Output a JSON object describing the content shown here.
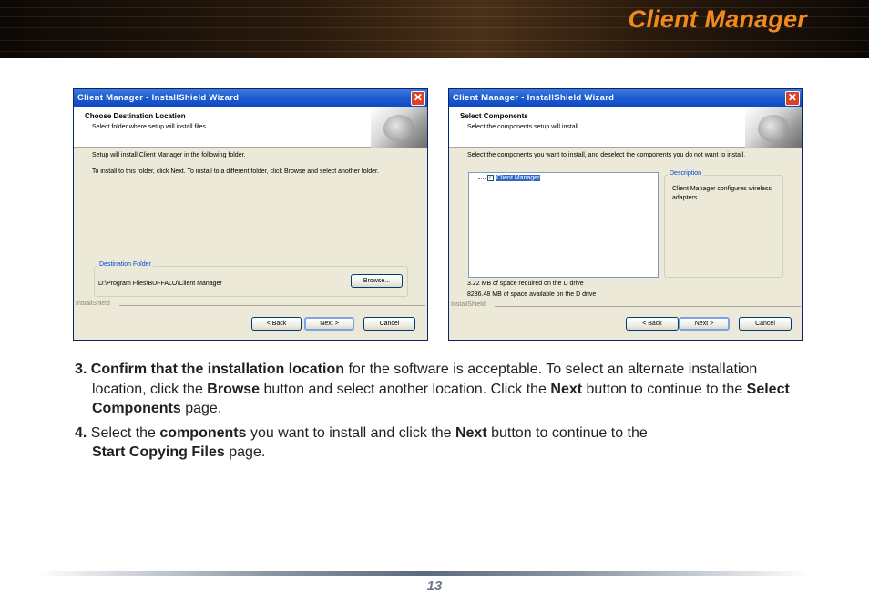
{
  "header": {
    "title": "Client Manager"
  },
  "dialog_left": {
    "window_title": "Client Manager - InstallShield Wizard",
    "close_glyph": "✕",
    "header_title": "Choose Destination Location",
    "header_subtitle": "Select folder where setup will install files.",
    "body_line1": "Setup will install Client Manager in the following folder.",
    "body_line2": "To install to this folder, click Next. To install to a different folder, click Browse and select another folder.",
    "group_label": "Destination Folder",
    "folder_path": "D:\\Program Files\\BUFFALO\\Client Manager",
    "browse_label": "Browse...",
    "installshield_label": "InstallShield",
    "back_label": "< Back",
    "next_label": "Next >",
    "cancel_label": "Cancel"
  },
  "dialog_right": {
    "window_title": "Client Manager - InstallShield Wizard",
    "close_glyph": "✕",
    "header_title": "Select Components",
    "header_subtitle": "Select the components setup will install.",
    "body_line1": "Select the components you want to install, and deselect the components you do not want to install.",
    "component_name": "Client Manager",
    "component_checked": true,
    "description_label": "Description",
    "description_text": "Client Manager configures wireless adapters.",
    "space_required": "3.22 MB of space required on the D drive",
    "space_available": "8236.48 MB of space available on the D drive",
    "installshield_label": "InstallShield",
    "back_label": "< Back",
    "next_label": "Next >",
    "cancel_label": "Cancel"
  },
  "steps": [
    {
      "number": "3.",
      "bold_lead": "Confirm that the installation location",
      "text1": " for the software is acceptable. To select an alternate installation location, click the ",
      "bold2": "Browse",
      "text2": " button and select another location. Click the ",
      "bold3": "Next",
      "text3": " button to continue to the ",
      "bold4": "Select Components",
      "text4": " page."
    },
    {
      "number": "4.",
      "text0": " Select the ",
      "bold1": "components",
      "text1": " you want to install and click the ",
      "bold2": "Next",
      "text2": " button to continue to the ",
      "bold3": "Start Copying Files",
      "text3": " page."
    }
  ],
  "footer": {
    "page_number": "13"
  },
  "colors": {
    "title_orange": "#f08a1e",
    "xp_blue": "#0d46c2",
    "footer_gray": "#6a7a8c"
  }
}
